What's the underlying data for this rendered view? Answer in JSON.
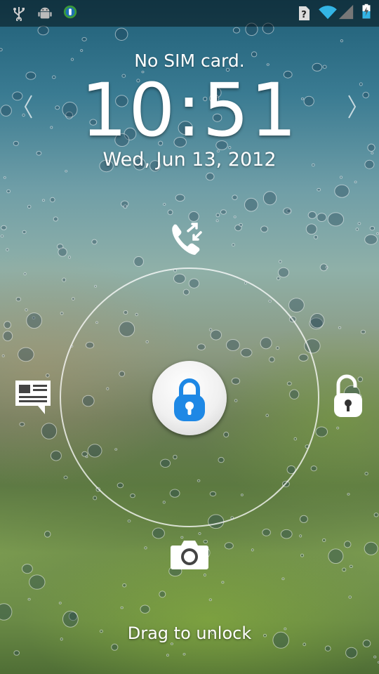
{
  "status_bar": {
    "left_icons": [
      "usb-icon",
      "android-debug-icon",
      "sync-app-icon"
    ],
    "right_icons": [
      "no-sim-icon",
      "wifi-icon",
      "signal-icon",
      "battery-charging-icon"
    ]
  },
  "lockscreen": {
    "carrier_text": "No SIM card.",
    "time": "10:51",
    "date": "Wed, Jun 13, 2012",
    "hint_text": "Drag to unlock",
    "targets": [
      "missed-calls-icon",
      "messages-icon",
      "unlock-icon",
      "camera-icon"
    ],
    "handle_icon": "padlock-icon",
    "accent_color": "#1e88e5"
  }
}
